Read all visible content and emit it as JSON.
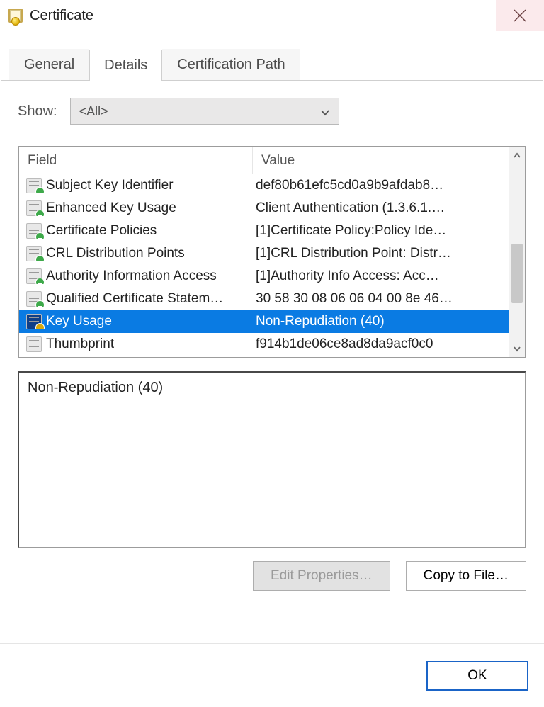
{
  "window": {
    "title": "Certificate"
  },
  "tabs": [
    {
      "label": "General",
      "active": false
    },
    {
      "label": "Details",
      "active": true
    },
    {
      "label": "Certification Path",
      "active": false
    }
  ],
  "show": {
    "label": "Show:",
    "selected": "<All>"
  },
  "columns": {
    "field": "Field",
    "value": "Value"
  },
  "rows": [
    {
      "icon": "ext",
      "field": "Subject Key Identifier",
      "value": "def80b61efc5cd0a9b9afdab8…",
      "selected": false
    },
    {
      "icon": "ext",
      "field": "Enhanced Key Usage",
      "value": "Client Authentication (1.3.6.1.…",
      "selected": false
    },
    {
      "icon": "ext",
      "field": "Certificate Policies",
      "value": "[1]Certificate Policy:Policy Ide…",
      "selected": false
    },
    {
      "icon": "ext",
      "field": "CRL Distribution Points",
      "value": "[1]CRL Distribution Point: Distr…",
      "selected": false
    },
    {
      "icon": "ext",
      "field": "Authority Information Access",
      "value": "[1]Authority Info Access: Acc…",
      "selected": false
    },
    {
      "icon": "ext",
      "field": "Qualified Certificate Statem…",
      "value": "30 58 30 08 06 06 04 00 8e 46…",
      "selected": false
    },
    {
      "icon": "crit",
      "field": "Key Usage",
      "value": "Non-Repudiation (40)",
      "selected": true
    },
    {
      "icon": "prop",
      "field": "Thumbprint",
      "value": "f914b1de06ce8ad8da9acf0c0",
      "selected": false
    }
  ],
  "detail_text": "Non-Repudiation (40)",
  "buttons": {
    "edit_properties": "Edit Properties…",
    "copy_to_file": "Copy to File…",
    "ok": "OK"
  }
}
